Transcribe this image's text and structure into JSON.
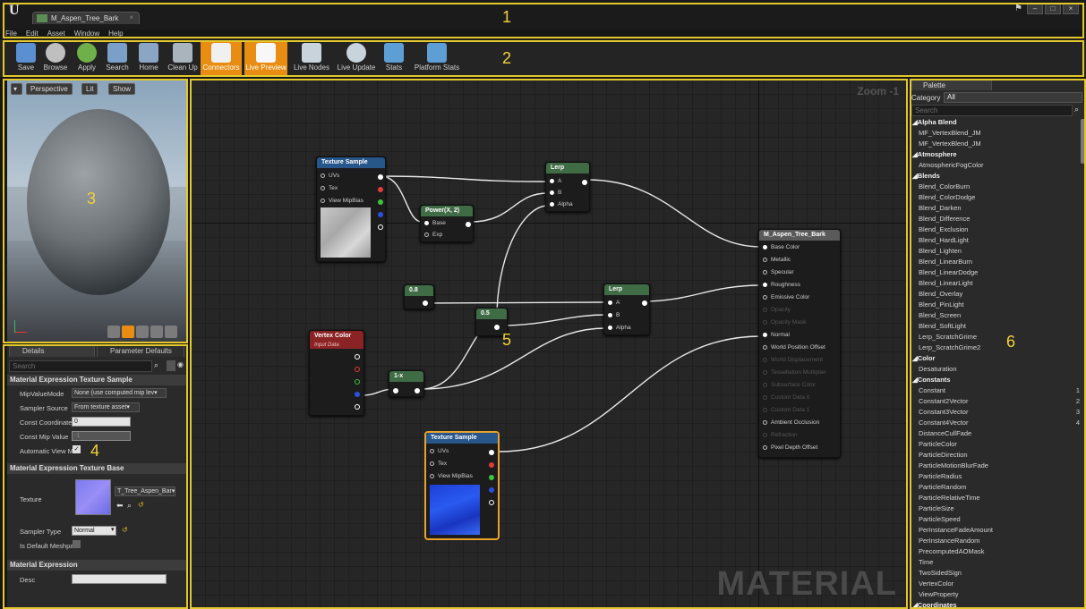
{
  "title_bar": {
    "logo": "U",
    "document_tab": "M_Aspen_Tree_Bark",
    "menu": [
      "File",
      "Edit",
      "Asset",
      "Window",
      "Help"
    ],
    "window_controls": [
      "–",
      "□",
      "×"
    ],
    "region_number": "1"
  },
  "toolbar": {
    "region_number": "2",
    "buttons": [
      {
        "label": "Save",
        "icon": "save-icon",
        "color": "#5a8fd1"
      },
      {
        "label": "Browse",
        "icon": "magnifier-icon",
        "color": "#bfbfbf"
      },
      {
        "label": "Apply",
        "icon": "checkmark-icon",
        "color": "#6fb04a"
      },
      {
        "label": "Search",
        "icon": "search-icon",
        "color": "#7aa0c8"
      },
      {
        "label": "Home",
        "icon": "home-icon",
        "color": "#8aa6c4"
      },
      {
        "label": "Clean Up",
        "icon": "broom-icon",
        "color": "#a9b4bd"
      },
      {
        "label": "Connectors",
        "icon": "connectors-icon",
        "color": "#f0f0f0",
        "active": true
      },
      {
        "label": "Live Preview",
        "icon": "live-preview-icon",
        "color": "#f7f7f7",
        "active": true
      },
      {
        "label": "Live Nodes",
        "icon": "live-nodes-icon",
        "color": "#c9d3db"
      },
      {
        "label": "Live Update",
        "icon": "live-update-icon",
        "color": "#c9d3db"
      },
      {
        "label": "Stats",
        "icon": "stats-icon",
        "color": "#5d9fd4"
      },
      {
        "label": "Platform Stats",
        "icon": "platform-stats-icon",
        "color": "#5d9fd4"
      }
    ]
  },
  "viewport": {
    "region_number": "3",
    "buttons": [
      "Perspective",
      "Lit",
      "Show"
    ]
  },
  "details": {
    "region_number": "4",
    "tabs": [
      "Details",
      "Parameter Defaults"
    ],
    "search_placeholder": "Search",
    "section1": "Material Expression Texture Sample",
    "mip_value_mode_label": "MipValueMode",
    "mip_value_mode_value": "None (use computed mip lev▾",
    "sampler_source_label": "Sampler Source",
    "sampler_source_value": "From texture asset▾",
    "const_coordinate_label": "Const Coordinate",
    "const_coordinate_value": "0",
    "const_mip_label": "Const Mip Value",
    "const_mip_value": "-1",
    "auto_view_label": "Automatic View M",
    "section2": "Material Expression Texture Base",
    "texture_label": "Texture",
    "texture_value": "T_Tree_Aspen_Bar▾",
    "sampler_type_label": "Sampler Type",
    "sampler_type_value": "Normal",
    "default_mesh_label": "Is Default Meshpa",
    "section3": "Material Expression",
    "desc_label": "Desc"
  },
  "graph": {
    "region_number": "5",
    "zoom": "Zoom -1",
    "watermark": "MATERIAL",
    "nodes": {
      "texture_sample_1": {
        "title": "Texture Sample",
        "pins": [
          "UVs",
          "Tex",
          "View MipBias"
        ]
      },
      "power": {
        "title": "Power(X, 2)",
        "pins": [
          "Base",
          "Exp"
        ]
      },
      "lerp_1": {
        "title": "Lerp",
        "pins": [
          "A",
          "B",
          "Alpha"
        ]
      },
      "const_08": {
        "title": "0.8"
      },
      "const_05": {
        "title": "0.5"
      },
      "lerp_2": {
        "title": "Lerp",
        "pins": [
          "A",
          "B",
          "Alpha"
        ]
      },
      "vertex_color": {
        "title": "Vertex Color",
        "subtitle": "Input Data"
      },
      "one_minus": {
        "title": "1-x"
      },
      "texture_sample_2": {
        "title": "Texture Sample",
        "pins": [
          "UVs",
          "Tex",
          "View MipBias"
        ]
      },
      "result": {
        "title": "M_Aspen_Tree_Bark",
        "pins": [
          "Base Color",
          "Metallic",
          "Specular",
          "Roughness",
          "Emissive Color",
          "Opacity",
          "Opacity Mask",
          "Normal",
          "World Position Offset",
          "World Displacement",
          "Tessellation Multiplier",
          "Subsurface Color",
          "Custom Data 0",
          "Custom Data 1",
          "Ambient Occlusion",
          "Refraction",
          "Pixel Depth Offset"
        ]
      }
    }
  },
  "palette": {
    "region_number": "6",
    "tab": "Palette",
    "category_label": "Category",
    "category_value": "All",
    "search_placeholder": "Search",
    "rows": [
      {
        "t": "Alpha Blend",
        "cat": true
      },
      {
        "t": "MF_VertexBlend_JM"
      },
      {
        "t": "MF_VertexBlend_JM"
      },
      {
        "t": "Atmosphere",
        "cat": true
      },
      {
        "t": "AtmosphericFogColor"
      },
      {
        "t": "Blends",
        "cat": true
      },
      {
        "t": "Blend_ColorBurn"
      },
      {
        "t": "Blend_ColorDodge"
      },
      {
        "t": "Blend_Darken"
      },
      {
        "t": "Blend_Difference"
      },
      {
        "t": "Blend_Exclusion"
      },
      {
        "t": "Blend_HardLight"
      },
      {
        "t": "Blend_Lighten"
      },
      {
        "t": "Blend_LinearBurn"
      },
      {
        "t": "Blend_LinearDodge"
      },
      {
        "t": "Blend_LinearLight"
      },
      {
        "t": "Blend_Overlay"
      },
      {
        "t": "Blend_PinLight"
      },
      {
        "t": "Blend_Screen"
      },
      {
        "t": "Blend_SoftLight"
      },
      {
        "t": "Lerp_ScratchGrime"
      },
      {
        "t": "Lerp_ScratchGrime2"
      },
      {
        "t": "Color",
        "cat": true
      },
      {
        "t": "Desaturation"
      },
      {
        "t": "Constants",
        "cat": true
      },
      {
        "t": "Constant",
        "hk": "1"
      },
      {
        "t": "Constant2Vector",
        "hk": "2"
      },
      {
        "t": "Constant3Vector",
        "hk": "3"
      },
      {
        "t": "Constant4Vector",
        "hk": "4"
      },
      {
        "t": "DistanceCullFade"
      },
      {
        "t": "ParticleColor"
      },
      {
        "t": "ParticleDirection"
      },
      {
        "t": "ParticleMotionBlurFade"
      },
      {
        "t": "ParticleRadius"
      },
      {
        "t": "ParticleRandom"
      },
      {
        "t": "ParticleRelativeTime"
      },
      {
        "t": "ParticleSize"
      },
      {
        "t": "ParticleSpeed"
      },
      {
        "t": "PerInstanceFadeAmount"
      },
      {
        "t": "PerInstanceRandom"
      },
      {
        "t": "PrecomputedAOMask"
      },
      {
        "t": "Time"
      },
      {
        "t": "TwoSidedSign"
      },
      {
        "t": "VertexColor"
      },
      {
        "t": "ViewProperty"
      },
      {
        "t": "Coordinates",
        "cat": true
      }
    ]
  }
}
